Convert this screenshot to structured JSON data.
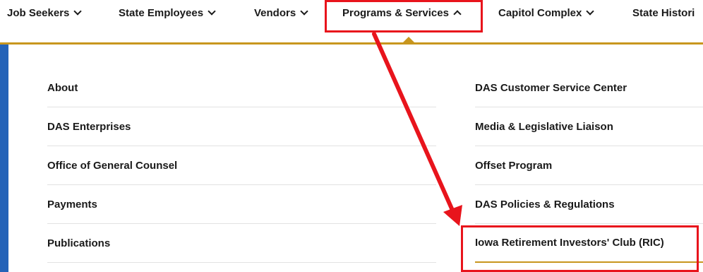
{
  "nav": {
    "items": [
      {
        "label": "Job Seekers",
        "expanded": false
      },
      {
        "label": "State Employees",
        "expanded": false
      },
      {
        "label": "Vendors",
        "expanded": false
      },
      {
        "label": "Programs & Services",
        "expanded": true
      },
      {
        "label": "Capitol Complex",
        "expanded": false
      },
      {
        "label": "State Histori",
        "expanded": false
      }
    ]
  },
  "menu": {
    "left": [
      "About",
      "DAS Enterprises",
      "Office of General Counsel",
      "Payments",
      "Publications"
    ],
    "right": [
      "DAS Customer Service Center",
      "Media & Legislative Liaison",
      "Offset Program",
      "DAS Policies & Regulations",
      "Iowa Retirement Investors' Club (RIC)"
    ]
  },
  "colors": {
    "accent_gold": "#c8961e",
    "side_blue": "#2463b8",
    "annotation_red": "#e8141c"
  },
  "icons": [
    "chevron-down-icon",
    "chevron-up-icon"
  ]
}
